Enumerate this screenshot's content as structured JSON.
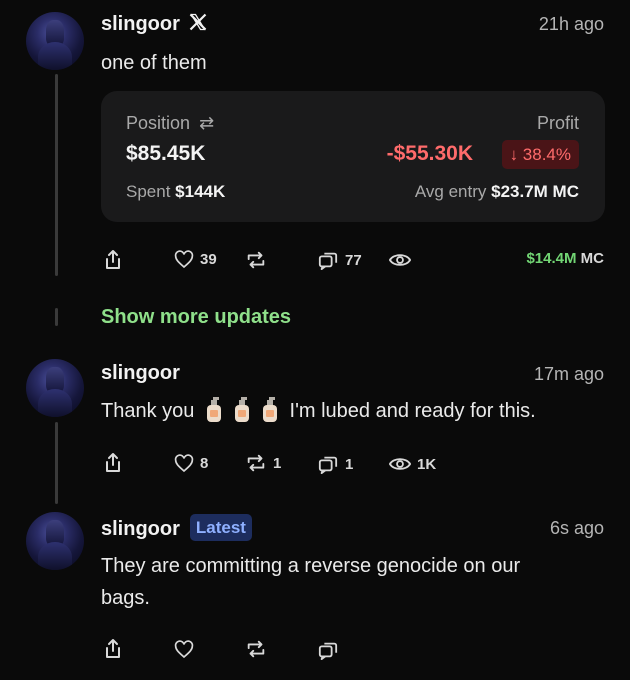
{
  "posts": [
    {
      "author": "slingoor",
      "verified_icon": "x-logo-icon",
      "time": "21h ago",
      "text": "one of them",
      "position_card": {
        "position_label": "Position",
        "position_value": "$85.45K",
        "profit_label": "Profit",
        "profit_value": "-$55.30K",
        "profit_pct": "↓ 38.4%",
        "spent_label": "Spent",
        "spent_value": "$144K",
        "avg_entry_label": "Avg entry",
        "avg_entry_value": "$23.7M MC"
      },
      "actions": {
        "likes": "39",
        "quotes": "77"
      },
      "market_cap": {
        "value": "$14.4M",
        "unit": "MC"
      }
    },
    {
      "author": "slingoor",
      "time": "17m ago",
      "text_before": "Thank you",
      "text_after": "I'm lubed and ready for this.",
      "emojis": [
        "lotion-bottle",
        "lotion-bottle",
        "lotion-bottle"
      ],
      "actions": {
        "likes": "8",
        "reposts": "1",
        "quotes": "1",
        "views": "1K"
      }
    },
    {
      "author": "slingoor",
      "badge": "Latest",
      "time": "6s ago",
      "text_line1": "They are committing a reverse genocide on our",
      "text_line2": "bags."
    }
  ],
  "show_more": "Show more updates",
  "colors": {
    "accent_green": "#8fe08a",
    "loss_red": "#ff6b6b",
    "badge_blue": "#8fb0ff"
  }
}
